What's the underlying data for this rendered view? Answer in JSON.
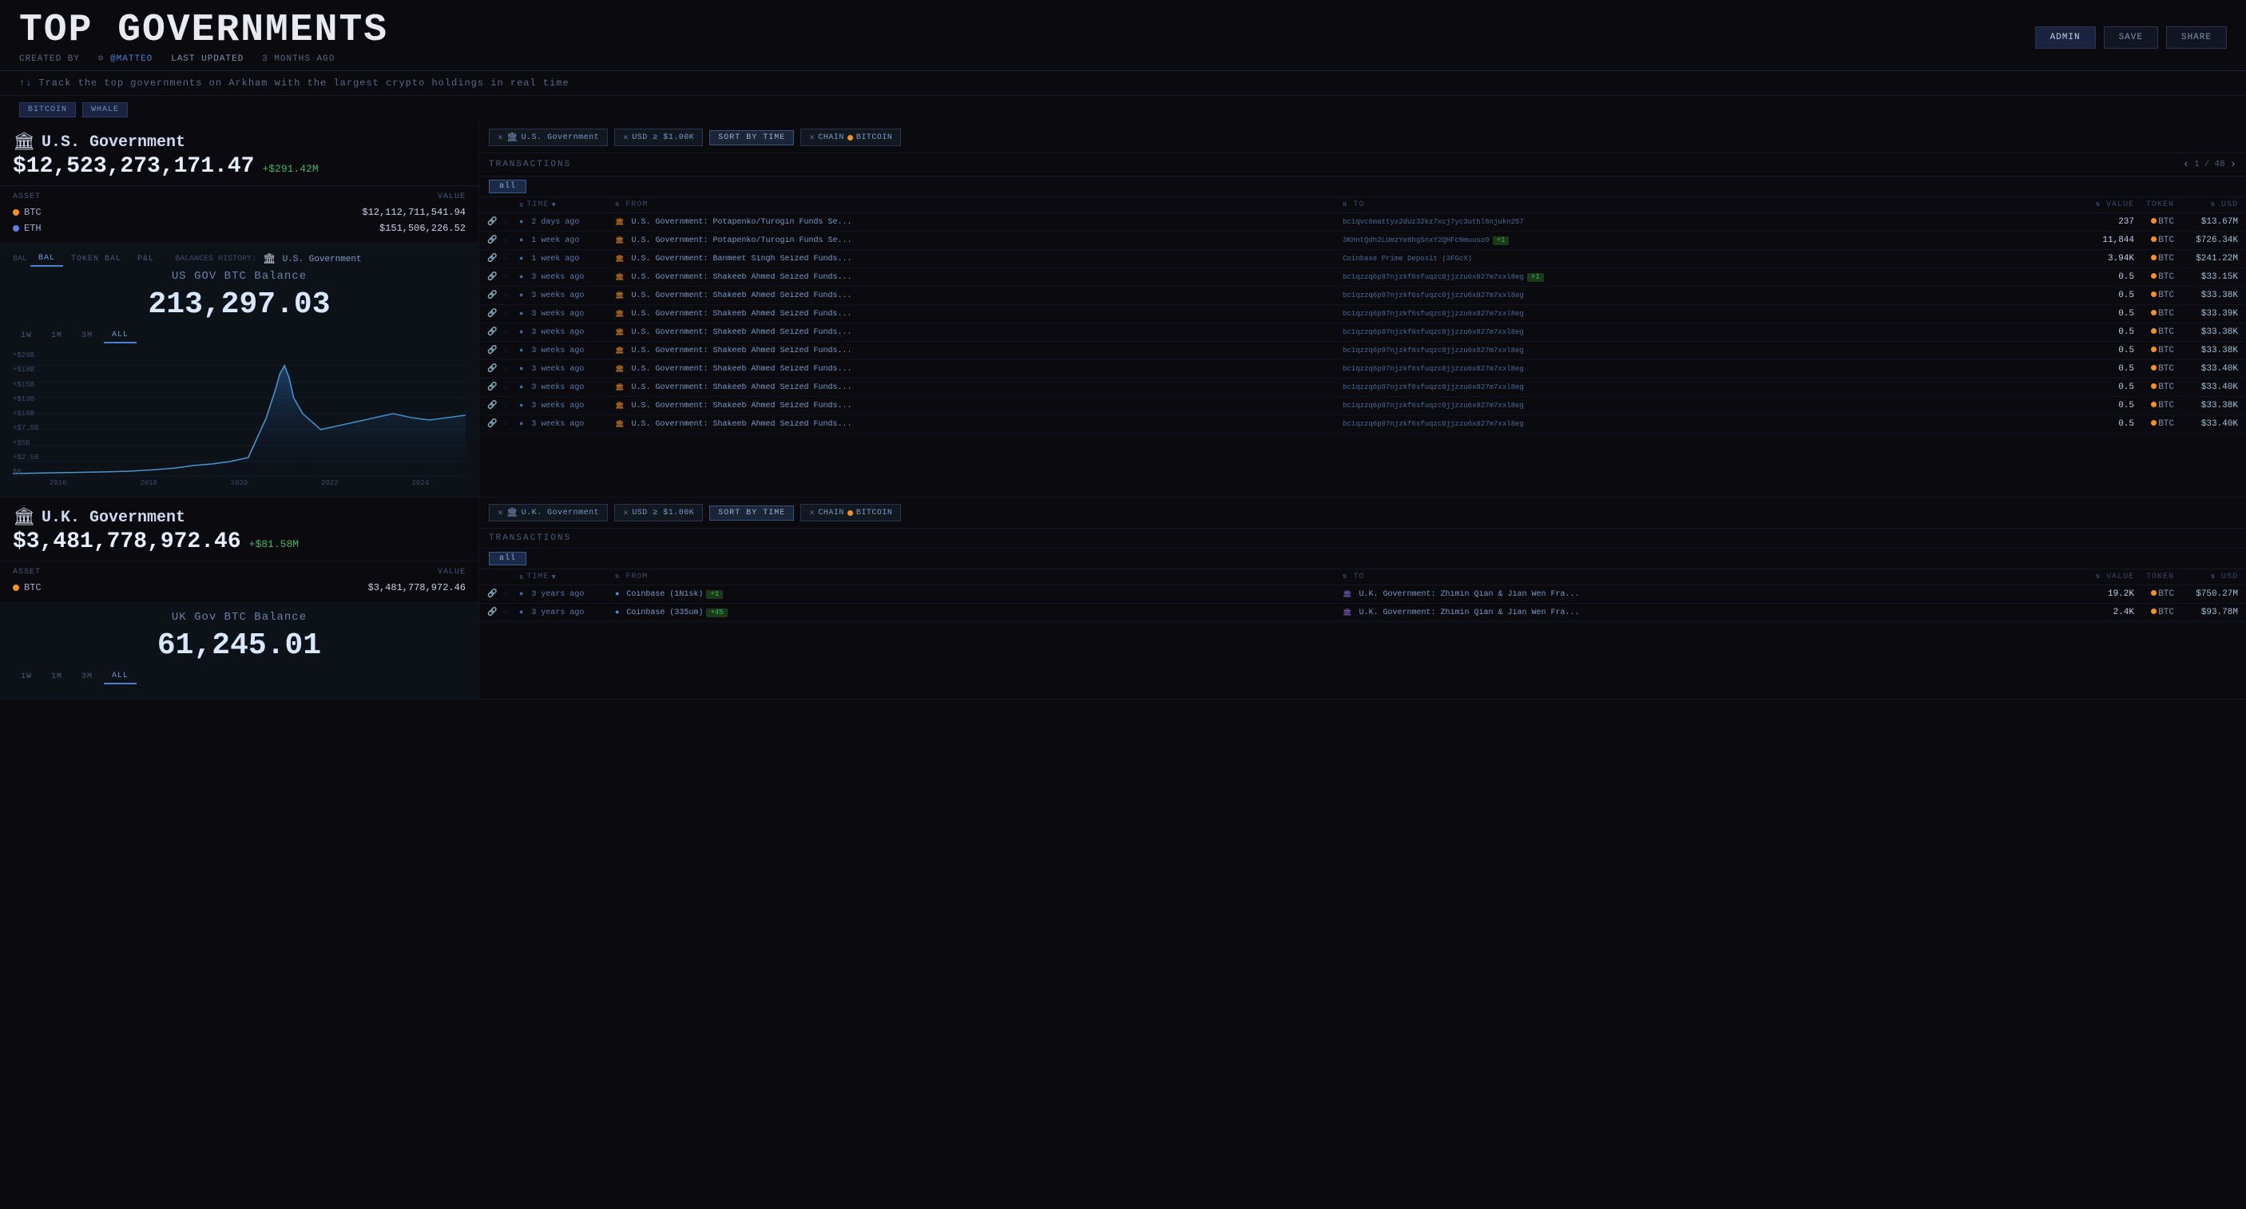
{
  "header": {
    "title": "TOP GOVERNMENTS",
    "subtitle": "Track the top governments on Arkham with the largest crypto holdings in real time",
    "created_by_label": "CREATED BY",
    "author": "@MATTEO",
    "updated_label": "LAST UPDATED",
    "updated_time": "3 MONTHS AGO",
    "buttons": {
      "admin": "ADMIN",
      "save": "SAVE",
      "share": "SHARE"
    }
  },
  "tags": [
    "BITCOIN",
    "WHALE"
  ],
  "sections": [
    {
      "id": "us-gov",
      "icon": "🏛",
      "name": "U.S. Government",
      "balance": "$12,523,273,171.47",
      "change": "+$291.42M",
      "assets": [
        {
          "symbol": "BTC",
          "type": "btc",
          "value": "$12,112,711,541.94"
        },
        {
          "symbol": "ETH",
          "type": "eth",
          "value": "$151,506,226.52"
        }
      ],
      "chart_title": "US GOV BTC Balance",
      "chart_value": "213,297.03",
      "history_tabs": [
        "1W",
        "1M",
        "3M",
        "ALL"
      ],
      "active_tab": "ALL",
      "entity_label": "U.S. Government",
      "bal_tabs": [
        {
          "label": "BAL",
          "active": true
        },
        {
          "label": "TOKEN BAL",
          "active": false
        },
        {
          "label": "P&L",
          "active": false
        }
      ],
      "x_labels": [
        "2016",
        "2018",
        "2020",
        "2022",
        "2024"
      ],
      "y_labels": [
        "+$20B",
        "+$18B",
        "+$15B",
        "+$13B",
        "+$10B",
        "+$7.5B",
        "+$5B",
        "+$2.5B",
        "$0"
      ],
      "filters": [
        {
          "type": "gov",
          "label": "U.S. Government",
          "icon": "🏛"
        },
        {
          "type": "usd",
          "label": "USD ≥ $1.00K"
        },
        {
          "type": "sort",
          "label": "SORT BY TIME"
        },
        {
          "type": "chain",
          "label": "CHAIN",
          "chain": "BITCOIN"
        }
      ],
      "transactions_title": "TRANSACTIONS",
      "pagination": {
        "current": 1,
        "total": 48
      },
      "active_filter": "all",
      "columns": {
        "time": "TIME",
        "from": "FROM",
        "to": "TO",
        "value": "VALUE",
        "token": "TOKEN",
        "usd": "USD"
      },
      "rows": [
        {
          "time": "2 days ago",
          "from": "U.S. Government: Potapenko/Turogin Funds Se...",
          "to": "bc1qvc6mattyx2duz32kz7xcj7yc3uthl6njukn257",
          "value": "237",
          "token": "BTC",
          "usd": "$13.67M",
          "badge": null
        },
        {
          "time": "1 week ago",
          "from": "U.S. Government: Potapenko/Turogin Funds Se...",
          "to": "3KHntQdh2LUmzYe8hgSnxY2QHFcNmuuso9",
          "value": "11,844",
          "token": "BTC",
          "usd": "$726.34K",
          "badge": "+1"
        },
        {
          "time": "1 week ago",
          "from": "U.S. Government: Banmeet Singh Seized Funds...",
          "to": "Coinbase Prime Deposit (3FGcX)",
          "value": "3.94K",
          "token": "BTC",
          "usd": "$241.22M",
          "badge": null
        },
        {
          "time": "3 weeks ago",
          "from": "U.S. Government: Shakeeb Ahmed Seized Funds...",
          "to": "bc1qzzq6p97njzkf6sfuqzc0jjzzu6x827m7xxl8eg",
          "value": "0.5",
          "token": "BTC",
          "usd": "$33.15K",
          "badge": "+1"
        },
        {
          "time": "3 weeks ago",
          "from": "U.S. Government: Shakeeb Ahmed Seized Funds...",
          "to": "bc1qzzq6p97njzkf6sfuqzc0jjzzu6x827m7xxl8eg",
          "value": "0.5",
          "token": "BTC",
          "usd": "$33.38K",
          "badge": null
        },
        {
          "time": "3 weeks ago",
          "from": "U.S. Government: Shakeeb Ahmed Seized Funds...",
          "to": "bc1qzzq6p97njzkf6sfuqzc0jjzzu6x827m7xxl8eg",
          "value": "0.5",
          "token": "BTC",
          "usd": "$33.39K",
          "badge": null
        },
        {
          "time": "3 weeks ago",
          "from": "U.S. Government: Shakeeb Ahmed Seized Funds...",
          "to": "bc1qzzq6p97njzkf6sfuqzc0jjzzu6x827m7xxl8eg",
          "value": "0.5",
          "token": "BTC",
          "usd": "$33.38K",
          "badge": null
        },
        {
          "time": "3 weeks ago",
          "from": "U.S. Government: Shakeeb Ahmed Seized Funds...",
          "to": "bc1qzzq6p97njzkf6sfuqzc0jjzzu6x827m7xxl8eg",
          "value": "0.5",
          "token": "BTC",
          "usd": "$33.38K",
          "badge": null
        },
        {
          "time": "3 weeks ago",
          "from": "U.S. Government: Shakeeb Ahmed Seized Funds...",
          "to": "bc1qzzq6p97njzkf6sfuqzc0jjzzu6x827m7xxl8eg",
          "value": "0.5",
          "token": "BTC",
          "usd": "$33.40K",
          "badge": null
        },
        {
          "time": "3 weeks ago",
          "from": "U.S. Government: Shakeeb Ahmed Seized Funds...",
          "to": "bc1qzzq6p97njzkf6sfuqzc0jjzzu6x827m7xxl8eg",
          "value": "0.5",
          "token": "BTC",
          "usd": "$33.40K",
          "badge": null
        },
        {
          "time": "3 weeks ago",
          "from": "U.S. Government: Shakeeb Ahmed Seized Funds...",
          "to": "bc1qzzq6p97njzkf6sfuqzc0jjzzu6x827m7xxl8eg",
          "value": "0.5",
          "token": "BTC",
          "usd": "$33.38K",
          "badge": null
        },
        {
          "time": "3 weeks ago",
          "from": "U.S. Government: Shakeeb Ahmed Seized Funds...",
          "to": "bc1qzzq6p97njzkf6sfuqzc0jjzzu6x827m7xxl8eg",
          "value": "0.5",
          "token": "BTC",
          "usd": "$33.40K",
          "badge": null
        }
      ]
    },
    {
      "id": "uk-gov",
      "icon": "🏛",
      "name": "U.K. Government",
      "balance": "$3,481,778,972.46",
      "change": "+$81.58M",
      "assets": [
        {
          "symbol": "BTC",
          "type": "btc",
          "value": "$3,481,778,972.46"
        }
      ],
      "chart_title": "UK Gov BTC Balance",
      "chart_value": "61,245.01",
      "history_tabs": [
        "1W",
        "1M",
        "3M",
        "ALL"
      ],
      "active_tab": "ALL",
      "filters": [
        {
          "type": "gov",
          "label": "U.K. Government",
          "icon": "🏛"
        },
        {
          "type": "usd",
          "label": "USD ≥ $1.00K"
        },
        {
          "type": "sort",
          "label": "SORT BY TIME"
        },
        {
          "type": "chain",
          "label": "CHAIN",
          "chain": "BITCOIN"
        }
      ],
      "transactions_title": "TRANSACTIONS",
      "active_filter": "all",
      "rows": [
        {
          "time": "3 years ago",
          "from": "Coinbase (1N1sk)",
          "from_badge": "+1",
          "to": "U.K. Government: Zhimin Qian & Jian Wen Fra...",
          "value": "19.2K",
          "token": "BTC",
          "usd": "$750.27M",
          "badge": null
        },
        {
          "time": "3 years ago",
          "from": "Coinbase (335um)",
          "from_badge": "+45",
          "to": "U.K. Government: Zhimin Qian & Jian Wen Fra...",
          "value": "2.4K",
          "token": "BTC",
          "usd": "$93.78M",
          "badge": null
        }
      ]
    }
  ]
}
